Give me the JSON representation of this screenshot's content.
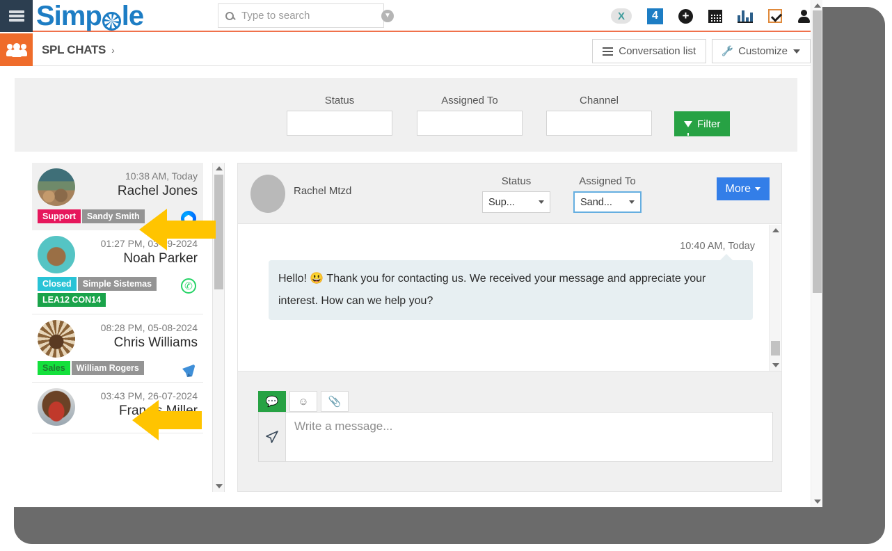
{
  "navbar": {
    "hamburger": "menu-icon",
    "brand": {
      "before": "Simp",
      "after": "le"
    },
    "search": {
      "placeholder": "Type to search",
      "value": ""
    },
    "icons": [
      {
        "name": "xing-badge-icon",
        "label": "X"
      },
      {
        "name": "notification-count-badge",
        "label": "4"
      },
      {
        "name": "add-circle-icon",
        "label": "+"
      },
      {
        "name": "calendar-icon",
        "label": ""
      },
      {
        "name": "bar-chart-icon",
        "label": ""
      },
      {
        "name": "checkbox-task-icon",
        "label": ""
      },
      {
        "name": "user-account-icon",
        "label": ""
      }
    ]
  },
  "breadcrumb": {
    "icon": "group-users-icon",
    "title": "SPL CHATS",
    "chevron": "›",
    "conversation_list_label": "Conversation list",
    "customize_label": "Customize"
  },
  "filter": {
    "fields": [
      {
        "label": "Status",
        "value": "",
        "name": "status-filter-input"
      },
      {
        "label": "Assigned To",
        "value": "",
        "name": "assigned-to-filter-input"
      },
      {
        "label": "Channel",
        "value": "",
        "name": "channel-filter-input"
      }
    ],
    "button_label": "Filter"
  },
  "conversations": [
    {
      "time": "10:38 AM, Today",
      "name": "Rachel Jones",
      "selected": true,
      "avatar_class": "av-rachel",
      "tags": [
        {
          "text": "Support",
          "class": "tag-support"
        },
        {
          "text": "Sandy Smith",
          "class": "tag-gray"
        }
      ],
      "channel": "messenger"
    },
    {
      "time": "01:27 PM, 03-09-2024",
      "name": "Noah Parker",
      "selected": false,
      "avatar_class": "av-noah",
      "tags": [
        {
          "text": "Closed",
          "class": "tag-closed"
        },
        {
          "text": "Simple Sistemas",
          "class": "tag-gray"
        },
        {
          "text": "LEA12   CON14",
          "class": "tag-green"
        }
      ],
      "channel": "whatsapp"
    },
    {
      "time": "08:28 PM, 05-08-2024",
      "name": "Chris Williams",
      "selected": false,
      "avatar_class": "av-chris",
      "tags": [
        {
          "text": "Sales",
          "class": "tag-sales"
        },
        {
          "text": "William Rogers",
          "class": "tag-gray"
        }
      ],
      "channel": "telegram"
    },
    {
      "time": "03:43 PM, 26-07-2024",
      "name": "Francis Miller",
      "selected": false,
      "avatar_class": "av-francis",
      "tags": [],
      "channel": "none"
    }
  ],
  "chat": {
    "contact_name": "Rachel Mtzd",
    "status": {
      "label": "Status",
      "value": "Sup..."
    },
    "assigned_to": {
      "label": "Assigned To",
      "value": "Sand..."
    },
    "more_label": "More",
    "message": {
      "time": "10:40 AM, Today",
      "text": "Hello! 😃 Thank you for contacting us. We received your message and appreciate your interest. How can we help you?"
    },
    "composer": {
      "tabs": [
        {
          "name": "chat-tab",
          "glyph": "💬",
          "active": true
        },
        {
          "name": "emoji-tab",
          "glyph": "☺",
          "active": false
        },
        {
          "name": "attachment-tab",
          "glyph": "📎",
          "active": false
        }
      ],
      "placeholder": "Write a message...",
      "value": "",
      "send_icon": "send-paper-plane-icon"
    }
  },
  "annotations": {
    "arrow_color": "#FFC400",
    "arrows": [
      {
        "name": "annotation-arrow-sandy-smith"
      },
      {
        "name": "annotation-arrow-william-rogers"
      }
    ]
  }
}
